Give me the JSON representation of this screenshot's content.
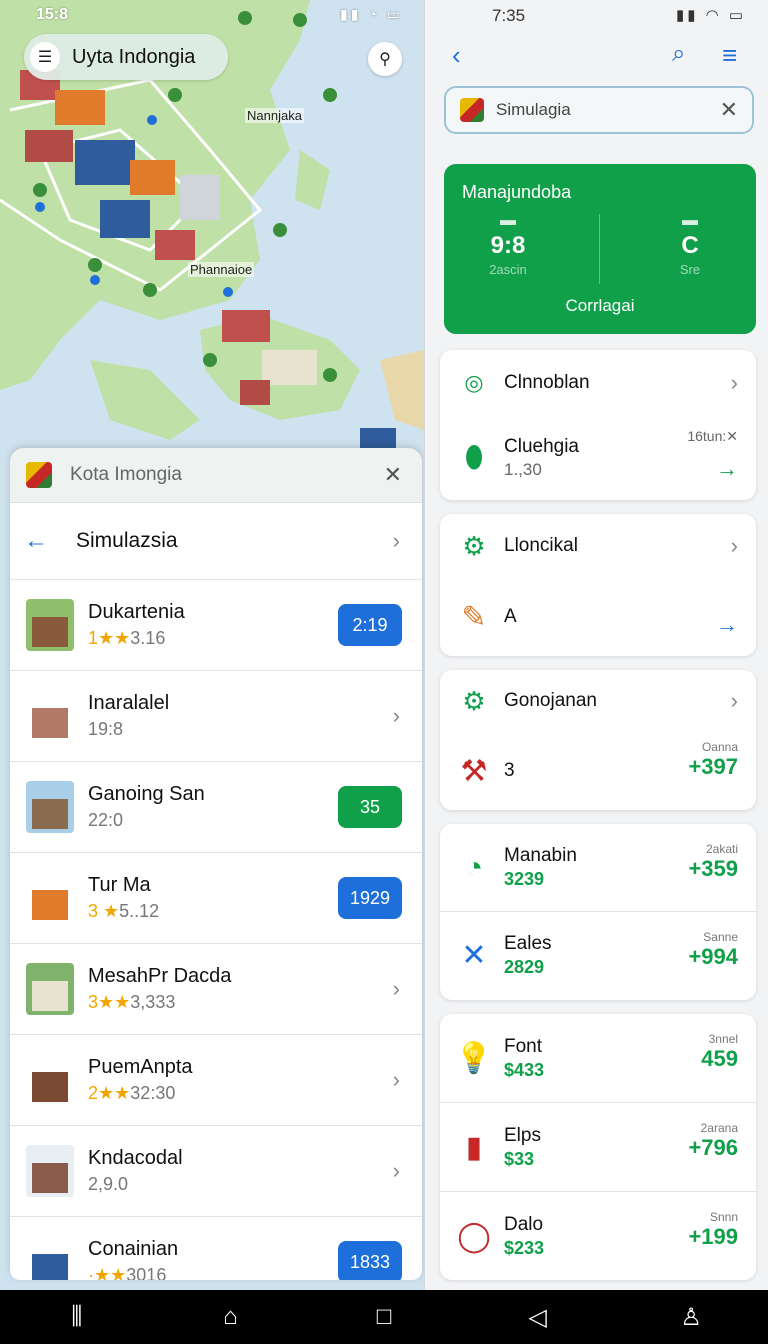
{
  "left_status": {
    "time": "15:8",
    "icons": "▮▮ ◔ ▭"
  },
  "map": {
    "search_text": "Uyta Indongia",
    "labels": [
      "Nannjaka",
      "Phannaioe"
    ]
  },
  "sheet": {
    "header_title": "Kota Imongia",
    "sub_title": "Simulazsia",
    "items": [
      {
        "title": "Dukartenia",
        "stars": "1★★",
        "rating": "3.16",
        "badge": "2:19",
        "badge_color": "#1e6fd9",
        "thumb_bg": "#8fbf6a",
        "bld": "#8a5a3c"
      },
      {
        "title": "Inaralalel",
        "stars": "",
        "rating": "19:8",
        "badge": "",
        "badge_color": "",
        "thumb_bg": "#ffffff",
        "bld": "#b07a66"
      },
      {
        "title": "Ganoing San",
        "stars": "",
        "rating": "22:0",
        "badge": "35",
        "badge_color": "#11a04a",
        "thumb_bg": "#a9cfe8",
        "bld": "#8a6b4e"
      },
      {
        "title": "Tur Ma",
        "stars": "3 ★",
        "rating": "5..12",
        "badge": "1929",
        "badge_color": "#1e6fd9",
        "thumb_bg": "#ffffff",
        "bld": "#e07b2b"
      },
      {
        "title": "MesahPr Dacda",
        "stars": "3★★",
        "rating": "3,333",
        "badge": "",
        "badge_color": "",
        "thumb_bg": "#7fb26a",
        "bld": "#e8e2d0"
      },
      {
        "title": "PuemAnpta",
        "stars": "2★★",
        "rating": "32:30",
        "badge": "",
        "badge_color": "",
        "thumb_bg": "#ffffff",
        "bld": "#7a4a32"
      },
      {
        "title": "Kndacodal",
        "stars": "",
        "rating": "2,9.0",
        "badge": "",
        "badge_color": "",
        "thumb_bg": "#e9eef2",
        "bld": "#8a5a4a"
      },
      {
        "title": "Conainian",
        "stars": "·★★",
        "rating": "3016",
        "badge": "1833",
        "badge_color": "#1e6fd9",
        "thumb_bg": "#ffffff",
        "bld": "#2f5c9c"
      }
    ]
  },
  "right_status": {
    "time": "7:35",
    "icons": "▮▮ ◠ ▭"
  },
  "right_search": {
    "text": "Simulagia"
  },
  "summary_card": {
    "title": "Manajundoba",
    "stat1_value": "9:8",
    "stat1_label": "2ascin",
    "stat2_value": "C",
    "stat2_label": "Sre",
    "action": "Corrlagai"
  },
  "cards": [
    {
      "header": "Clnnoblan",
      "detail_title": "Cluehgia",
      "detail_sub": "1.,30",
      "right_note": "16tun:✕"
    },
    {
      "header": "Lloncikal",
      "detail_title": "A"
    },
    {
      "header": "Gonojanan",
      "detail_title": "3",
      "value_label": "Oanna",
      "value": "+397"
    }
  ],
  "finance_a": [
    {
      "name": "Manabin",
      "amount": "3239",
      "label": "2akati",
      "value": "+359"
    },
    {
      "name": "Eales",
      "amount": "2829",
      "label": "Sanne",
      "value": "+994"
    }
  ],
  "finance_b": [
    {
      "name": "Font",
      "amount": "$433",
      "label": "3nnel",
      "value": "459"
    },
    {
      "name": "Elps",
      "amount": "$33",
      "label": "2arana",
      "value": "+796"
    },
    {
      "name": "Dalo",
      "amount": "$233",
      "label": "Snnn",
      "value": "+199"
    }
  ],
  "colors": {
    "accent_blue": "#1e6fd9",
    "accent_green": "#11a04a"
  },
  "icons": {
    "system_nav": [
      "recents-icon",
      "home-icon",
      "square-icon",
      "back-icon",
      "person-icon"
    ]
  }
}
